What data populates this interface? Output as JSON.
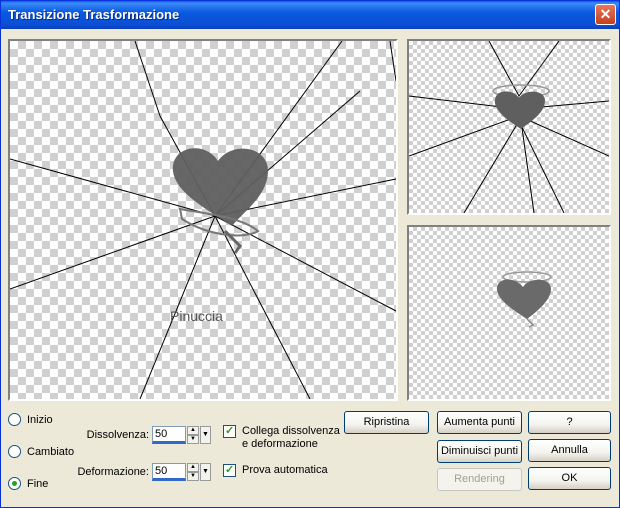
{
  "window": {
    "title": "Transizione Trasformazione",
    "close_glyph": "✕"
  },
  "preview": {
    "watermark": "Pinuccia",
    "heart_color": "#5F5F5F"
  },
  "modes": [
    {
      "label": "Inizio",
      "checked": false
    },
    {
      "label": "Cambiato",
      "checked": false
    },
    {
      "label": "Fine",
      "checked": true
    }
  ],
  "fields": {
    "dissolvenza": {
      "label": "Dissolvenza:",
      "value": "50"
    },
    "deformazione": {
      "label": "Deformazione:",
      "value": "50"
    }
  },
  "checks": {
    "collega": {
      "label_line1": "Collega dissolvenza",
      "label_line2": "e deformazione",
      "checked": true
    },
    "prova": {
      "label": "Prova automatica",
      "checked": true
    }
  },
  "buttons": {
    "ripristina": "Ripristina",
    "aumenta": "Aumenta punti",
    "diminuisci": "Diminuisci punti",
    "rendering": "Rendering",
    "help": "?",
    "annulla": "Annulla",
    "ok": "OK"
  }
}
